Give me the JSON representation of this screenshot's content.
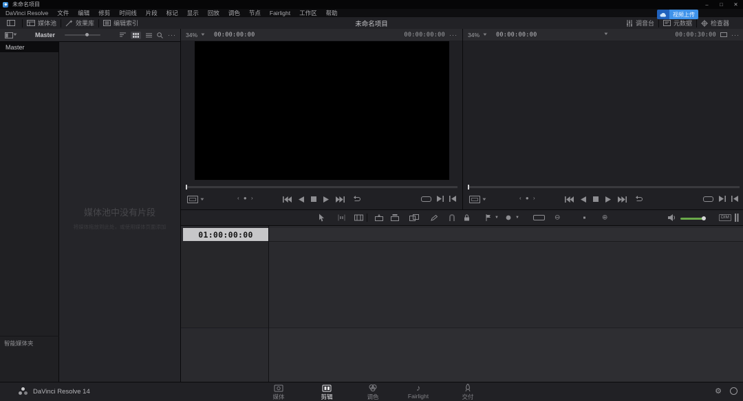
{
  "window": {
    "title": "未命名项目",
    "minimize": "–",
    "maximize": "□",
    "close": "✕"
  },
  "menus": [
    "DaVinci Resolve",
    "文件",
    "编辑",
    "修剪",
    "时间线",
    "片段",
    "标记",
    "显示",
    "回放",
    "调色",
    "节点",
    "Fairlight",
    "工作区",
    "帮助"
  ],
  "toolbar": {
    "media_pool": "媒体池",
    "effects_library": "效果库",
    "edit_index": "编辑索引",
    "project_title": "未命名项目",
    "mixer": "调音台",
    "metadata": "元数据",
    "inspector": "检查器",
    "upload_badge": "视频上传"
  },
  "media_pool": {
    "header_bin": "Master",
    "bin_selected": "Master",
    "smart_bins_label": "智能媒体夹",
    "empty_title": "媒体池中没有片段",
    "empty_hint": "将媒体拖放到此处，或使用媒体页面添加",
    "menu": "···"
  },
  "source_viewer": {
    "zoom_level": "34%",
    "current_timecode": "00:00:00:00",
    "duration_timecode": "00:00:00:00",
    "menu": "···"
  },
  "timeline_viewer": {
    "zoom_level": "34%",
    "current_timecode": "00:00:00:00",
    "duration_timecode": "00:00:30:00",
    "menu": "···"
  },
  "timeline": {
    "start_timecode": "01:00:00:00"
  },
  "audio_controls": {
    "dim_label": "DIM"
  },
  "status_bar": {
    "app_label": "DaVinci Resolve 14",
    "tabs": [
      {
        "id": "media",
        "label": "媒体",
        "active": false
      },
      {
        "id": "edit",
        "label": "剪辑",
        "active": true
      },
      {
        "id": "color",
        "label": "调色",
        "active": false
      },
      {
        "id": "fairlight",
        "label": "Fairlight",
        "active": false
      },
      {
        "id": "deliver",
        "label": "交付",
        "active": false
      }
    ]
  },
  "colors": {
    "accent": "#2f86e0",
    "volume_green": "#6aa94a",
    "badge_blue": "#3f93ea"
  }
}
